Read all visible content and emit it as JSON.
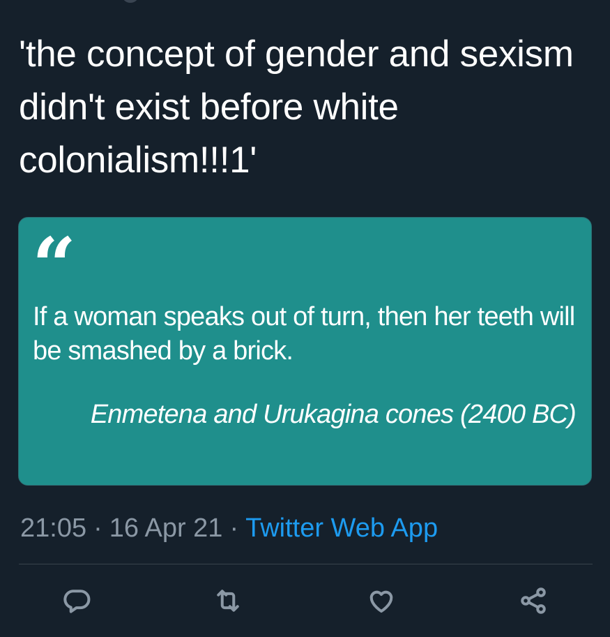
{
  "tweet": {
    "text": "'the concept of gender and sexism didn't exist before white colonialism!!!1'",
    "media": {
      "quote_icon": "quote-marks-icon",
      "quote_text": "If a woman speaks out of turn, then her teeth will be smashed by a brick.",
      "attribution": "Enmetena and Urukagina cones (2400 BC)",
      "background_color": "#1f8f8c"
    },
    "time": "21:05",
    "separator": "·",
    "date": "16 Apr 21",
    "source": "Twitter Web App",
    "source_color": "#1d9bf0"
  },
  "actions": [
    {
      "name": "reply",
      "icon": "reply-bubble-icon"
    },
    {
      "name": "retweet",
      "icon": "retweet-icon"
    },
    {
      "name": "like",
      "icon": "heart-icon"
    },
    {
      "name": "share",
      "icon": "share-icon"
    }
  ],
  "colors": {
    "background": "#15202b",
    "text": "#ffffff",
    "muted": "#8b98a5",
    "divider": "#38444d"
  }
}
